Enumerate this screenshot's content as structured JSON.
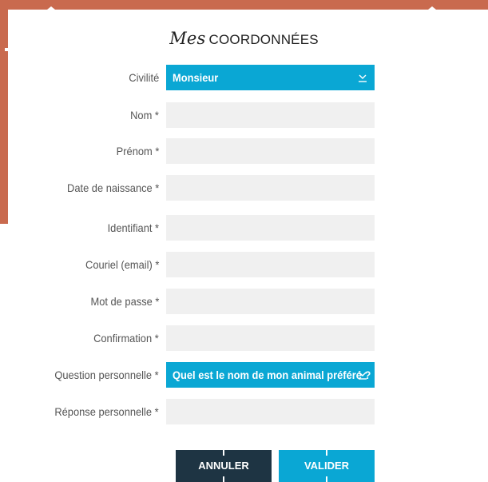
{
  "page": {
    "title_script": "Mes",
    "title_caps": "COORDONNÉES"
  },
  "colors": {
    "accent": "#0aa7d4",
    "cancel": "#1e3443",
    "frame": "#c96a4e",
    "field_bg": "#f0f0f0"
  },
  "form": {
    "civilite": {
      "label": "Civilité",
      "value": "Monsieur"
    },
    "nom": {
      "label": "Nom *",
      "value": ""
    },
    "prenom": {
      "label": "Prénom *",
      "value": ""
    },
    "date_naissance": {
      "label": "Date de naissance *",
      "value": ""
    },
    "identifiant": {
      "label": "Identifiant *",
      "value": ""
    },
    "courriel": {
      "label": "Couriel (email) *",
      "value": ""
    },
    "mot_de_passe": {
      "label": "Mot de passe *",
      "value": ""
    },
    "confirmation": {
      "label": "Confirmation *",
      "value": ""
    },
    "question": {
      "label": "Question personnelle *",
      "value": "Quel est le nom de mon animal préféré ?"
    },
    "reponse": {
      "label": "Réponse personnelle *",
      "value": ""
    }
  },
  "actions": {
    "cancel_label": "ANNULER",
    "submit_label": "VALIDER"
  },
  "icons": {
    "dropdown": "chevron-down-icon"
  }
}
